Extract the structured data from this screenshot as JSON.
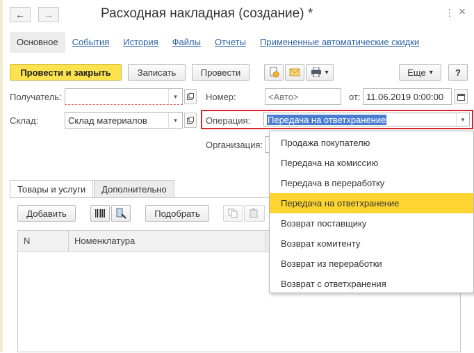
{
  "window": {
    "title": "Расходная накладная (создание) *",
    "back_glyph": "←",
    "forward_glyph": "→",
    "more_glyph": "⋮",
    "close_glyph": "×"
  },
  "sections": [
    {
      "label": "Основное"
    },
    {
      "label": "События"
    },
    {
      "label": "История"
    },
    {
      "label": "Файлы"
    },
    {
      "label": "Отчеты"
    },
    {
      "label": "Примененные автоматические скидки"
    }
  ],
  "toolbar": {
    "post_close": "Провести и закрыть",
    "save": "Записать",
    "post": "Провести",
    "more": "Еще",
    "help": "?",
    "dropdown_glyph": "▾"
  },
  "form": {
    "recipient_label": "Получатель:",
    "recipient_value": "",
    "number_label": "Номер:",
    "number_placeholder": "<Авто>",
    "date_label": "от:",
    "date_value": "11.06.2019  0:00:00",
    "warehouse_label": "Склад:",
    "warehouse_value": "Склад материалов",
    "operation_label": "Операция:",
    "operation_value": "Передача на ответхранение",
    "organization_label": "Организация:"
  },
  "operation_options": [
    {
      "label": "Продажа покупателю"
    },
    {
      "label": "Передача на комиссию"
    },
    {
      "label": "Передача в переработку"
    },
    {
      "label": "Передача на ответхранение",
      "selected": true
    },
    {
      "label": "Возврат поставщику"
    },
    {
      "label": "Возврат комитенту"
    },
    {
      "label": "Возврат из переработки"
    },
    {
      "label": "Возврат с ответхранения"
    }
  ],
  "inner_tabs": [
    {
      "label": "Товары и услуги"
    },
    {
      "label": "Дополнительно"
    }
  ],
  "goods_toolbar": {
    "add": "Добавить",
    "pick": "Подобрать"
  },
  "table": {
    "columns": [
      "N",
      "Номенклатура"
    ]
  },
  "colors": {
    "accent_yellow": "#fde24f",
    "selection_yellow": "#fed530",
    "highlight_red": "#d9262c",
    "link_blue": "#2b62a6",
    "text_selection_blue": "#4a7cd4"
  }
}
